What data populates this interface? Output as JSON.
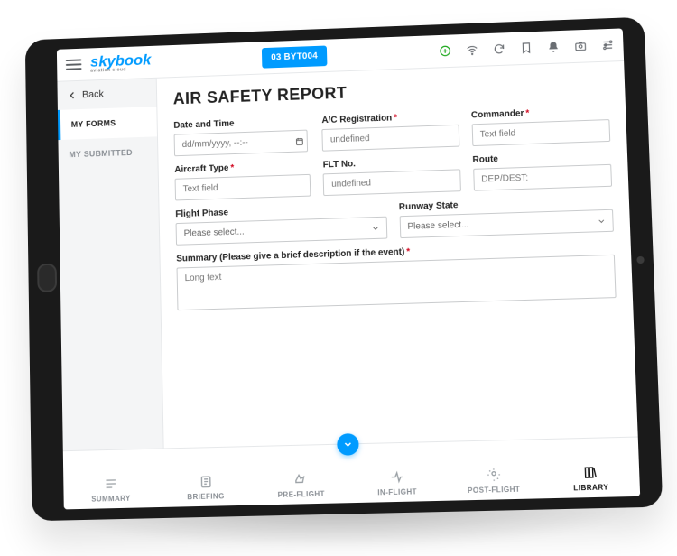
{
  "brand": {
    "name": "skybook",
    "tagline": "aviation cloud"
  },
  "flight_chip": "03 BYT004",
  "back_label": "Back",
  "sidebar": {
    "items": [
      {
        "label": "MY FORMS",
        "active": true
      },
      {
        "label": "MY SUBMITTED",
        "active": false
      }
    ]
  },
  "form": {
    "title": "AIR SAFETY REPORT",
    "fields": {
      "datetime": {
        "label": "Date and Time",
        "placeholder": "dd/mm/yyyy, --:--",
        "required": false
      },
      "ac_reg": {
        "label": "A/C Registration",
        "placeholder": "undefined",
        "required": true
      },
      "commander": {
        "label": "Commander",
        "placeholder": "Text field",
        "required": true
      },
      "aircraft_type": {
        "label": "Aircraft Type",
        "placeholder": "Text field",
        "required": true
      },
      "flt_no": {
        "label": "FLT No.",
        "placeholder": "undefined",
        "required": false
      },
      "route": {
        "label": "Route",
        "placeholder": "DEP/DEST:",
        "required": false
      },
      "flight_phase": {
        "label": "Flight Phase",
        "placeholder": "Please select...",
        "required": false
      },
      "runway_state": {
        "label": "Runway State",
        "placeholder": "Please select...",
        "required": false
      },
      "summary": {
        "label": "Summary (Please give a brief description if the event)",
        "placeholder": "Long text",
        "required": true
      }
    }
  },
  "bottom_nav": [
    {
      "label": "SUMMARY"
    },
    {
      "label": "BRIEFING"
    },
    {
      "label": "PRE-FLIGHT"
    },
    {
      "label": "IN-FLIGHT"
    },
    {
      "label": "POST-FLIGHT"
    },
    {
      "label": "LIBRARY",
      "active": true
    }
  ]
}
